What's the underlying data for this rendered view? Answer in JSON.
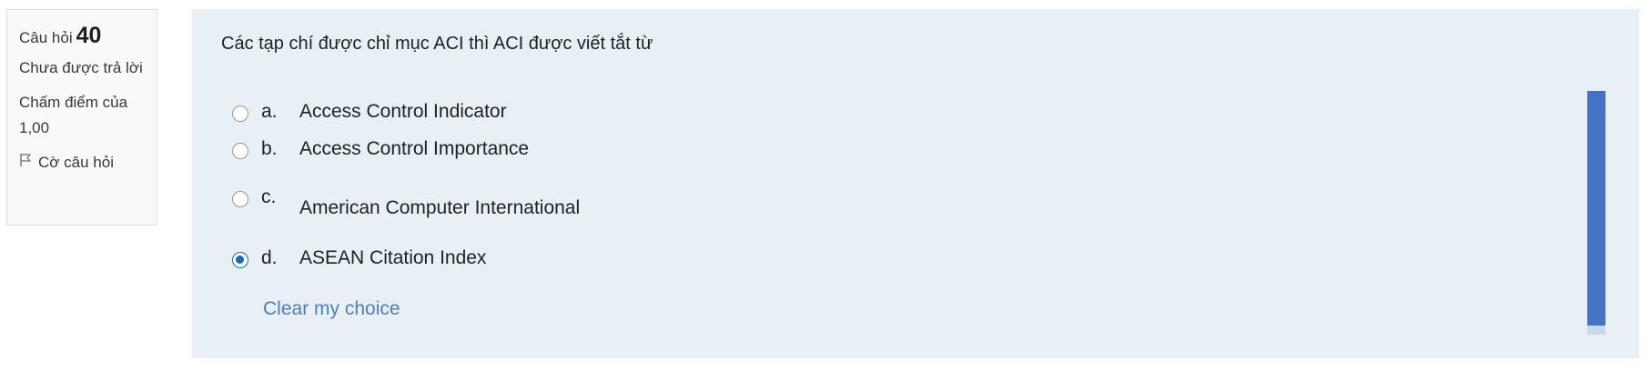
{
  "info": {
    "question_label": "Câu hỏi",
    "question_number": "40",
    "state": "Chưa được trả lời",
    "grade": "Chấm điểm của 1,00",
    "flag_label": "Cờ câu hỏi"
  },
  "question": {
    "text": "Các tạp chí được chỉ mục ACI thì ACI được viết tắt từ",
    "answers": [
      {
        "letter": "a.",
        "text": "Access Control Indicator",
        "checked": false
      },
      {
        "letter": "b.",
        "text": "Access Control Importance",
        "checked": false
      },
      {
        "letter": "c.",
        "text": "American Computer International",
        "checked": false
      },
      {
        "letter": "d.",
        "text": "ASEAN Citation Index",
        "checked": true
      }
    ],
    "clear_label": "Clear my choice"
  },
  "colors": {
    "panel_background": "#e8f0f5",
    "accent": "#0f6cbf",
    "link": "#4a7fc0",
    "scrollbar_thumb": "#4472c4"
  },
  "icons": {
    "flag": "flag-outline-icon"
  }
}
